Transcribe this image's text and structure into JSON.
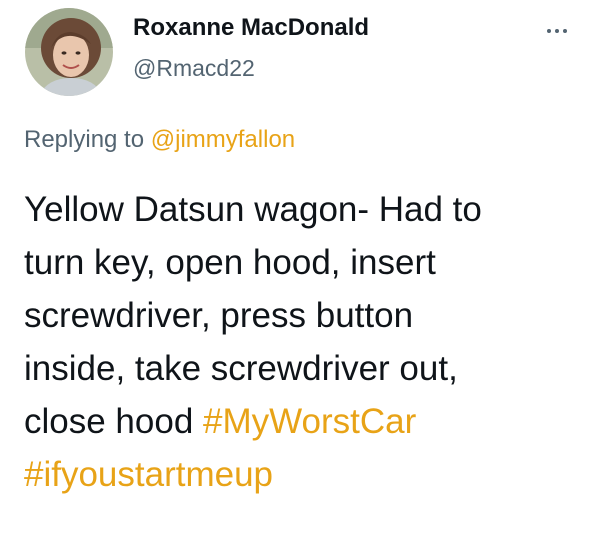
{
  "author": {
    "display_name": "Roxanne MacDonald",
    "handle": "@Rmacd22"
  },
  "reply": {
    "prefix": "Replying to ",
    "mention": "@jimmyfallon"
  },
  "body": {
    "line1": "Yellow Datsun wagon- Had to",
    "line2": "turn key, open hood, insert",
    "line3": "screwdriver, press button",
    "line4": "inside, take screwdriver out,",
    "line5_text": "close hood ",
    "hashtag1": "#MyWorstCar",
    "hashtag2": "#ifyoustartmeup"
  },
  "icons": {
    "more": "more-options-icon",
    "avatar": "profile-photo"
  },
  "colors": {
    "link": "#e8a317",
    "secondary_text": "#536471",
    "primary_text": "#0f1419"
  }
}
